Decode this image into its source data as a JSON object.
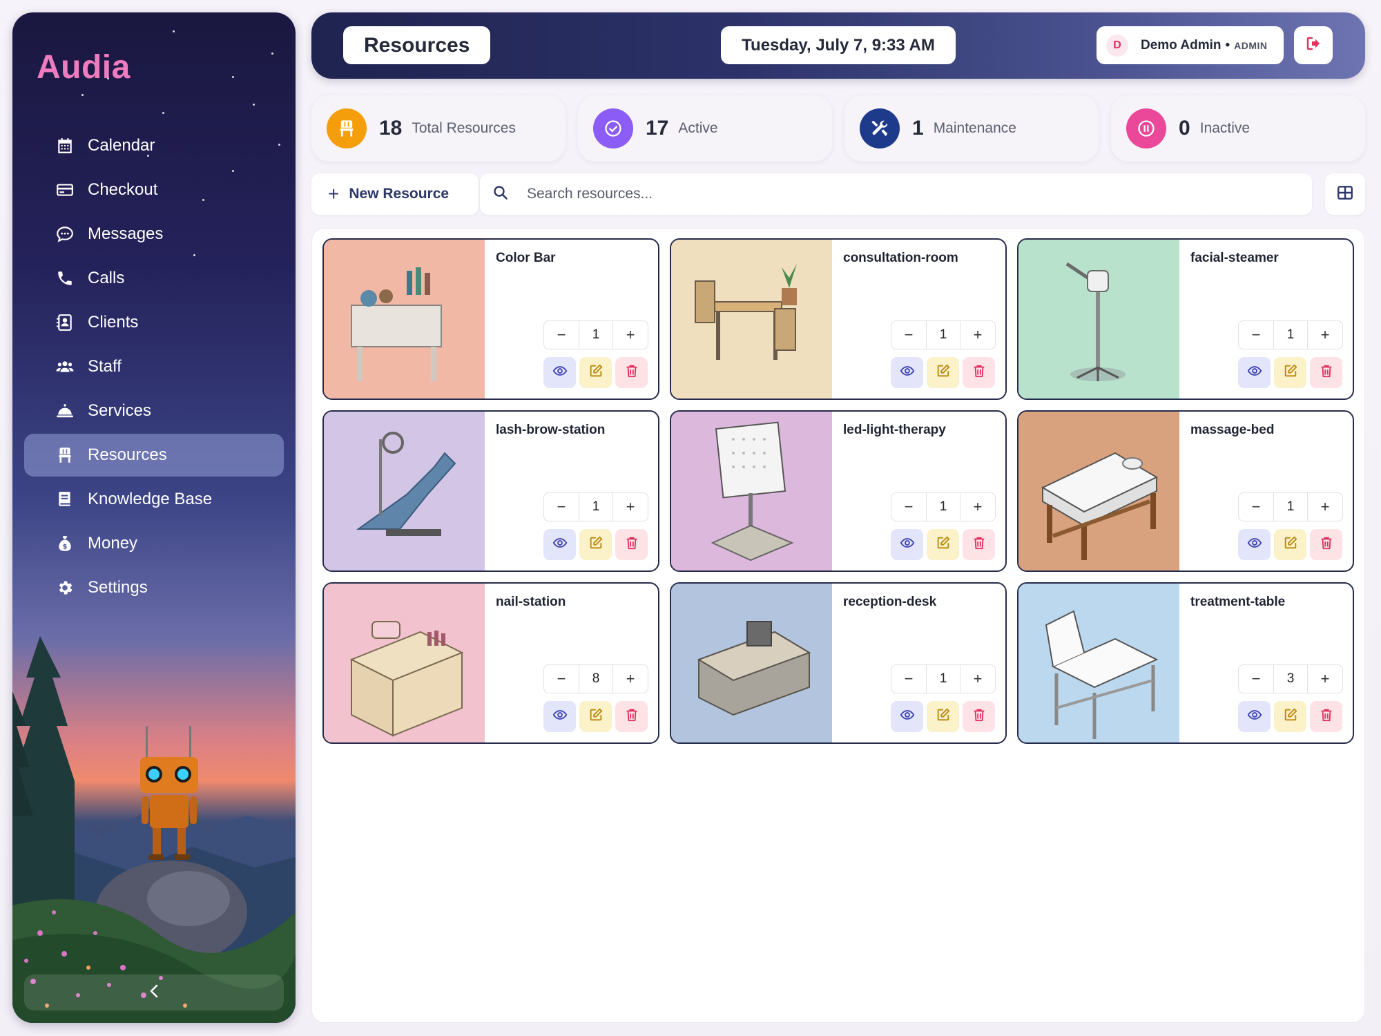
{
  "app": {
    "name": "Audia"
  },
  "sidebar": {
    "items": [
      {
        "label": "Calendar",
        "icon": "calendar-icon",
        "active": false
      },
      {
        "label": "Checkout",
        "icon": "credit-card-icon",
        "active": false
      },
      {
        "label": "Messages",
        "icon": "chat-bubble-icon",
        "active": false
      },
      {
        "label": "Calls",
        "icon": "phone-icon",
        "active": false
      },
      {
        "label": "Clients",
        "icon": "contact-card-icon",
        "active": false
      },
      {
        "label": "Staff",
        "icon": "users-icon",
        "active": false
      },
      {
        "label": "Services",
        "icon": "service-bell-icon",
        "active": false
      },
      {
        "label": "Resources",
        "icon": "chair-icon",
        "active": true
      },
      {
        "label": "Knowledge Base",
        "icon": "book-icon",
        "active": false
      },
      {
        "label": "Money",
        "icon": "money-bag-icon",
        "active": false
      },
      {
        "label": "Settings",
        "icon": "gear-icon",
        "active": false
      }
    ],
    "collapse_icon": "chevron-left-icon"
  },
  "header": {
    "title": "Resources",
    "datetime": "Tuesday, July 7, 9:33 AM",
    "user": {
      "initial": "D",
      "name": "Demo Admin",
      "separator": "•",
      "role": "ADMIN"
    },
    "logout_icon": "logout-icon"
  },
  "stats": [
    {
      "value": "18",
      "label": "Total Resources",
      "color": "#f59e0b",
      "icon": "chair-icon"
    },
    {
      "value": "17",
      "label": "Active",
      "color": "#8b5cf6",
      "icon": "check-circle-icon"
    },
    {
      "value": "1",
      "label": "Maintenance",
      "color": "#1e3a8a",
      "icon": "tools-icon"
    },
    {
      "value": "0",
      "label": "Inactive",
      "color": "#ec4899",
      "icon": "pause-circle-icon"
    }
  ],
  "toolbar": {
    "new_label": "New Resource",
    "search_placeholder": "Search resources...",
    "search_value": "",
    "view_toggle_icon": "grid-view-icon"
  },
  "resources": [
    {
      "name": "Color Bar",
      "quantity": "1",
      "bg": "#f2b8a6"
    },
    {
      "name": "consultation-room",
      "quantity": "1",
      "bg": "#efdfbf"
    },
    {
      "name": "facial-steamer",
      "quantity": "1",
      "bg": "#b8e2cc"
    },
    {
      "name": "lash-brow-station",
      "quantity": "1",
      "bg": "#d3c5e6"
    },
    {
      "name": "led-light-therapy",
      "quantity": "1",
      "bg": "#dcb8dc"
    },
    {
      "name": "massage-bed",
      "quantity": "1",
      "bg": "#d9a27f"
    },
    {
      "name": "nail-station",
      "quantity": "8",
      "bg": "#f2c2cf"
    },
    {
      "name": "reception-desk",
      "quantity": "1",
      "bg": "#b3c4df"
    },
    {
      "name": "treatment-table",
      "quantity": "3",
      "bg": "#bcd8ee"
    }
  ],
  "card_actions": {
    "decrement_symbol": "−",
    "increment_symbol": "+",
    "view_icon": "eye-icon",
    "edit_icon": "edit-icon",
    "delete_icon": "trash-icon"
  }
}
